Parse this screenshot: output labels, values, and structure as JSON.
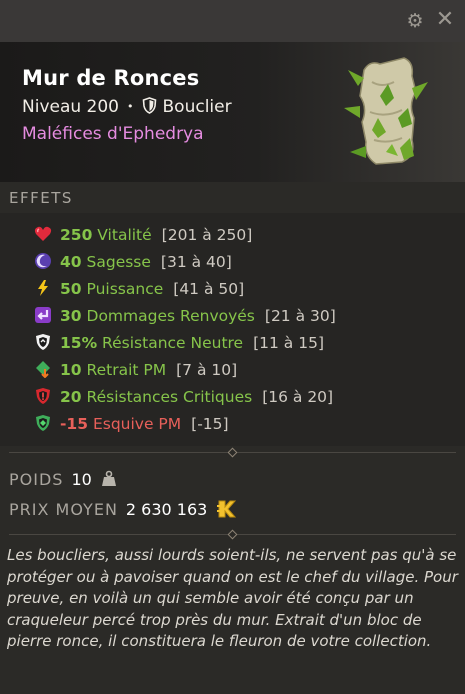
{
  "window": {
    "settings_icon": "gear-icon",
    "close_icon": "close-icon"
  },
  "item": {
    "name": "Mur de Ronces",
    "level": "Niveau 200",
    "separator": "•",
    "type": "Bouclier",
    "set": "Maléfices d'Ephedrya"
  },
  "effects_label": "EFFETS",
  "effects": [
    {
      "icon": "heart-icon",
      "value": "250",
      "name": "Vitalité",
      "range": "[201 à 250]",
      "color": "green"
    },
    {
      "icon": "moon-icon",
      "value": "40",
      "name": "Sagesse",
      "range": "[31 à 40]",
      "color": "green"
    },
    {
      "icon": "lightning-icon",
      "value": "50",
      "name": "Puissance",
      "range": "[41 à 50]",
      "color": "green"
    },
    {
      "icon": "return-arrow-icon",
      "value": "30",
      "name": "Dommages Renvoyés",
      "range": "[21 à 30]",
      "color": "green"
    },
    {
      "icon": "neutral-resistance-icon",
      "value": "15%",
      "name": "Résistance Neutre",
      "range": "[11 à 15]",
      "color": "green"
    },
    {
      "icon": "mp-removal-icon",
      "value": "10",
      "name": "Retrait PM",
      "range": "[7 à 10]",
      "color": "green"
    },
    {
      "icon": "critical-resistance-icon",
      "value": "20",
      "name": "Résistances Critiques",
      "range": "[16 à 20]",
      "color": "green"
    },
    {
      "icon": "mp-dodge-icon",
      "value": "-15",
      "name": "Esquive PM",
      "range": "[-15]",
      "color": "red"
    }
  ],
  "weight": {
    "label": "POIDS",
    "value": "10",
    "icon": "weight-icon"
  },
  "price": {
    "label": "PRIX MOYEN",
    "value": "2 630 163",
    "icon": "kamas-icon"
  },
  "description": "Les boucliers, aussi lourds soient-ils, ne servent pas qu'à se protéger ou à pavoiser quand on est le chef du village. Pour preuve, en voilà un qui semble avoir été conçu par un craqueleur percé trop près du mur. Extrait d'un bloc de pierre ronce, il constituera le fleuron de votre collection.",
  "colors": {
    "bonus": "#86c44a",
    "malus": "#e8605a",
    "set": "#e58ce0"
  }
}
